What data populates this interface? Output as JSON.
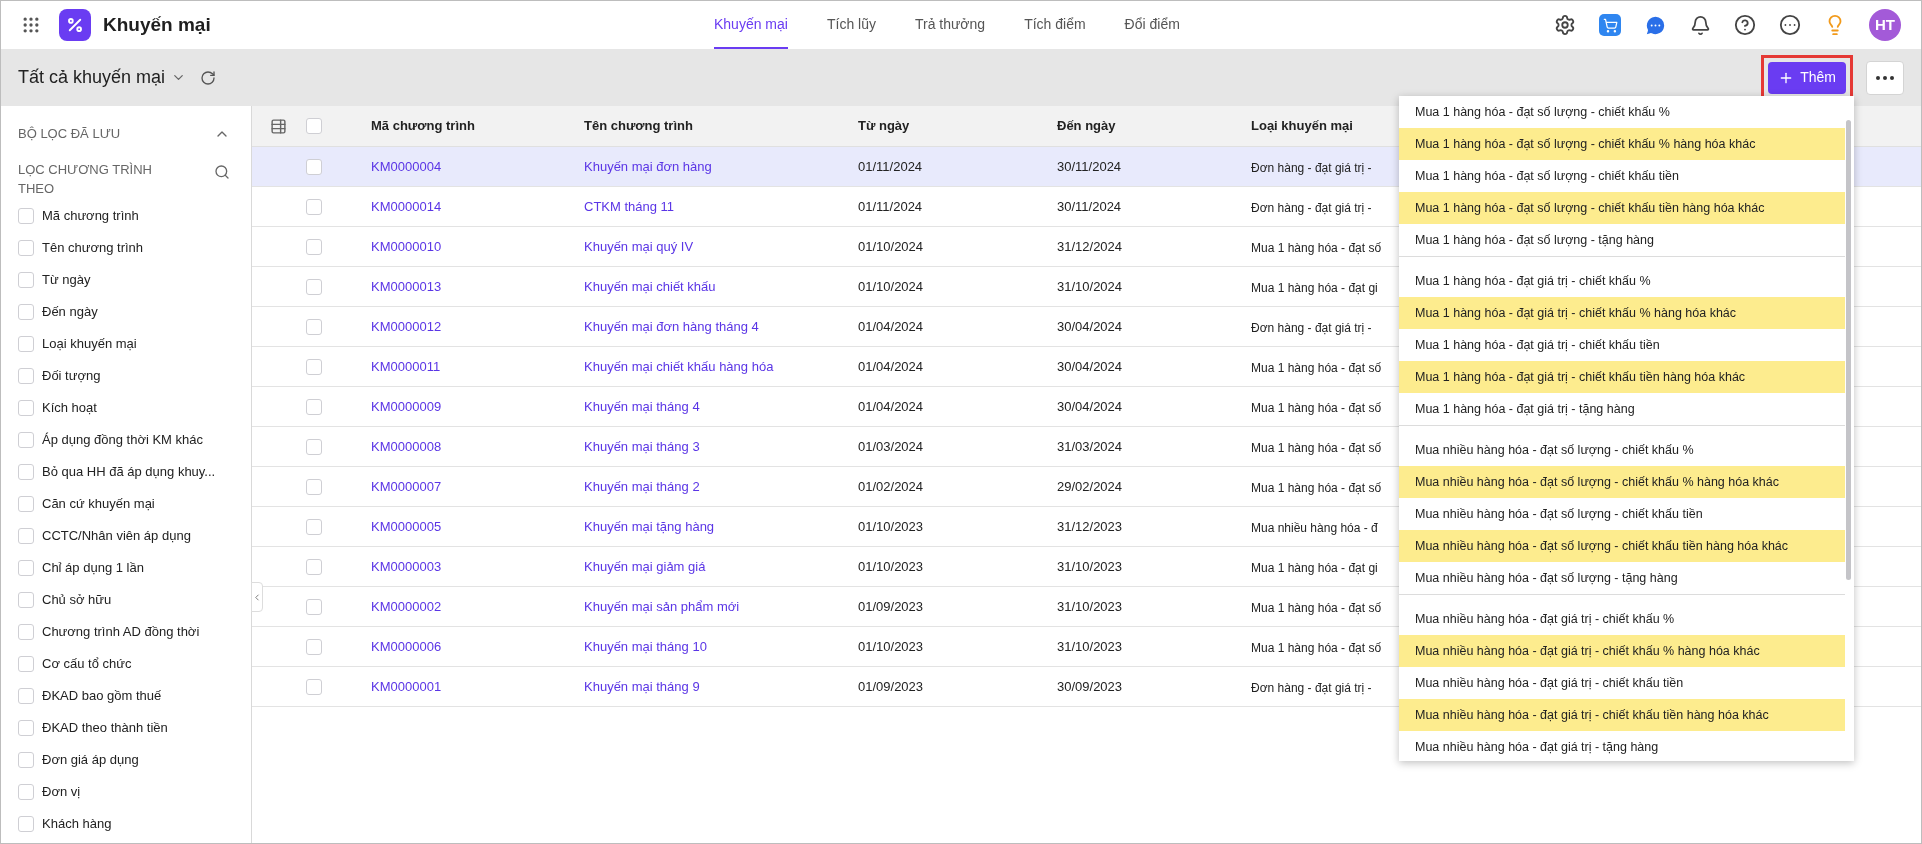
{
  "app": {
    "title": "Khuyến mại"
  },
  "tabs": [
    {
      "label": "Khuyến mại",
      "selected": true
    },
    {
      "label": "Tích lũy",
      "selected": false
    },
    {
      "label": "Trả thưởng",
      "selected": false
    },
    {
      "label": "Tích điểm",
      "selected": false
    },
    {
      "label": "Đổi điểm",
      "selected": false
    }
  ],
  "user": {
    "initials": "HT"
  },
  "toolbar": {
    "view": "Tất cả khuyến mại",
    "add_button": "Thêm"
  },
  "sidebar": {
    "saved_filters": "BỘ LỌC ĐÃ LƯU",
    "filter_by": "LỌC CHƯƠNG TRÌNH THEO",
    "filters": [
      {
        "label": "Mã chương trình",
        "checked": false
      },
      {
        "label": "Tên chương trình",
        "checked": false
      },
      {
        "label": "Từ ngày",
        "checked": false
      },
      {
        "label": "Đến ngày",
        "checked": false
      },
      {
        "label": "Loại khuyến mại",
        "checked": false
      },
      {
        "label": "Đối tượng",
        "checked": false
      },
      {
        "label": "Kích hoạt",
        "checked": false
      },
      {
        "label": "Áp dụng đồng thời KM khác",
        "checked": false
      },
      {
        "label": "Bỏ qua HH đã áp dụng khuy...",
        "checked": false
      },
      {
        "label": "Căn cứ khuyến mại",
        "checked": false
      },
      {
        "label": "CCTC/Nhân viên áp dụng",
        "checked": false
      },
      {
        "label": "Chỉ áp dụng 1 lần",
        "checked": false
      },
      {
        "label": "Chủ sở hữu",
        "checked": false
      },
      {
        "label": "Chương trình AD đồng thời",
        "checked": false
      },
      {
        "label": "Cơ cấu tổ chức",
        "checked": false
      },
      {
        "label": "ĐKAD bao gồm thuế",
        "checked": false
      },
      {
        "label": "ĐKAD theo thành tiền",
        "checked": false
      },
      {
        "label": "Đơn giá áp dụng",
        "checked": false
      },
      {
        "label": "Đơn vị",
        "checked": false
      },
      {
        "label": "Khách hàng",
        "checked": false
      }
    ]
  },
  "table": {
    "all_checked": false,
    "columns": [
      "Mã chương trình",
      "Tên chương trình",
      "Từ ngày",
      "Đến ngày",
      "Loại khuyến mại"
    ],
    "rows": [
      {
        "code": "KM0000004",
        "name": "Khuyến mại đơn hàng",
        "from": "01/11/2024",
        "to": "30/11/2024",
        "type": "Đơn hàng - đạt giá trị -",
        "selected": true,
        "checked": false
      },
      {
        "code": "KM0000014",
        "name": "CTKM tháng 11",
        "from": "01/11/2024",
        "to": "30/11/2024",
        "type": "Đơn hàng - đạt giá trị -",
        "selected": false,
        "checked": false
      },
      {
        "code": "KM0000010",
        "name": "Khuyến mại quý IV",
        "from": "01/10/2024",
        "to": "31/12/2024",
        "type": "Mua 1 hàng hóa - đạt số",
        "selected": false,
        "checked": false
      },
      {
        "code": "KM0000013",
        "name": "Khuyến mại chiết khấu",
        "from": "01/10/2024",
        "to": "31/10/2024",
        "type": "Mua 1 hàng hóa - đạt gi",
        "selected": false,
        "checked": false
      },
      {
        "code": "KM0000012",
        "name": "Khuyến mại đơn hàng tháng 4",
        "from": "01/04/2024",
        "to": "30/04/2024",
        "type": "Đơn hàng - đạt giá trị -",
        "selected": false,
        "checked": false
      },
      {
        "code": "KM0000011",
        "name": "Khuyến mại chiết khấu hàng hóa",
        "from": "01/04/2024",
        "to": "30/04/2024",
        "type": "Mua 1 hàng hóa - đạt số",
        "selected": false,
        "checked": false
      },
      {
        "code": "KM0000009",
        "name": "Khuyến mại tháng 4",
        "from": "01/04/2024",
        "to": "30/04/2024",
        "type": "Mua 1 hàng hóa - đạt số",
        "selected": false,
        "checked": false
      },
      {
        "code": "KM0000008",
        "name": "Khuyến mại tháng 3",
        "from": "01/03/2024",
        "to": "31/03/2024",
        "type": "Mua 1 hàng hóa - đạt số",
        "selected": false,
        "checked": false
      },
      {
        "code": "KM0000007",
        "name": "Khuyến mại tháng 2",
        "from": "01/02/2024",
        "to": "29/02/2024",
        "type": "Mua 1 hàng hóa - đạt số",
        "selected": false,
        "checked": false
      },
      {
        "code": "KM0000005",
        "name": "Khuyến mại tặng hàng",
        "from": "01/10/2023",
        "to": "31/12/2023",
        "type": "Mua nhiều hàng hóa - đ",
        "selected": false,
        "checked": false
      },
      {
        "code": "KM0000003",
        "name": "Khuyến mại giảm giá",
        "from": "01/10/2023",
        "to": "31/10/2023",
        "type": "Mua 1 hàng hóa - đạt gi",
        "selected": false,
        "checked": false
      },
      {
        "code": "KM0000002",
        "name": "Khuyến mại sản phẩm mới",
        "from": "01/09/2023",
        "to": "31/10/2023",
        "type": "Mua 1 hàng hóa - đạt số",
        "selected": false,
        "checked": false
      },
      {
        "code": "KM0000006",
        "name": "Khuyến mại tháng 10",
        "from": "01/10/2023",
        "to": "31/10/2023",
        "type": "Mua 1 hàng hóa - đạt số",
        "selected": false,
        "checked": false
      },
      {
        "code": "KM0000001",
        "name": "Khuyến mại tháng 9",
        "from": "01/09/2023",
        "to": "30/09/2023",
        "type": "Đơn hàng - đạt giá trị -",
        "selected": false,
        "checked": false
      }
    ]
  },
  "dropdown": {
    "groups": [
      {
        "items": [
          {
            "label": "Mua 1 hàng hóa - đạt số lượng - chiết khấu %",
            "highlighted": false
          },
          {
            "label": "Mua 1 hàng hóa - đạt số lượng - chiết khấu % hàng hóa khác",
            "highlighted": true
          },
          {
            "label": "Mua 1 hàng hóa - đạt số lượng - chiết khấu tiền",
            "highlighted": false
          },
          {
            "label": "Mua 1 hàng hóa - đạt số lượng - chiết khấu tiền hàng hóa khác",
            "highlighted": true
          },
          {
            "label": "Mua 1 hàng hóa - đạt số lượng - tặng hàng",
            "highlighted": false
          }
        ]
      },
      {
        "items": [
          {
            "label": "Mua 1 hàng hóa - đạt giá trị - chiết khấu %",
            "highlighted": false
          },
          {
            "label": "Mua 1 hàng hóa - đạt giá trị - chiết khấu % hàng hóa khác",
            "highlighted": true
          },
          {
            "label": "Mua 1 hàng hóa - đạt giá trị - chiết khấu tiền",
            "highlighted": false
          },
          {
            "label": "Mua 1 hàng hóa - đạt giá trị - chiết khấu tiền hàng hóa khác",
            "highlighted": true
          },
          {
            "label": "Mua 1 hàng hóa - đạt giá trị - tặng hàng",
            "highlighted": false
          }
        ]
      },
      {
        "items": [
          {
            "label": "Mua nhiều hàng hóa - đạt số lượng - chiết khấu %",
            "highlighted": false
          },
          {
            "label": "Mua nhiều hàng hóa - đạt số lượng - chiết khấu % hàng hóa khác",
            "highlighted": true
          },
          {
            "label": "Mua nhiều hàng hóa - đạt số lượng - chiết khấu tiền",
            "highlighted": false
          },
          {
            "label": "Mua nhiều hàng hóa - đạt số lượng - chiết khấu tiền hàng hóa khác",
            "highlighted": true
          },
          {
            "label": "Mua nhiều hàng hóa - đạt số lượng - tặng hàng",
            "highlighted": false
          }
        ]
      },
      {
        "items": [
          {
            "label": "Mua nhiều hàng hóa - đạt giá trị - chiết khấu %",
            "highlighted": false
          },
          {
            "label": "Mua nhiều hàng hóa - đạt giá trị - chiết khấu % hàng hóa khác",
            "highlighted": true
          },
          {
            "label": "Mua nhiều hàng hóa - đạt giá trị - chiết khấu tiền",
            "highlighted": false
          },
          {
            "label": "Mua nhiều hàng hóa - đạt giá trị - chiết khấu tiền hàng hóa khác",
            "highlighted": true
          },
          {
            "label": "Mua nhiều hàng hóa - đạt giá trị - tặng hàng",
            "highlighted": false
          }
        ]
      }
    ]
  }
}
